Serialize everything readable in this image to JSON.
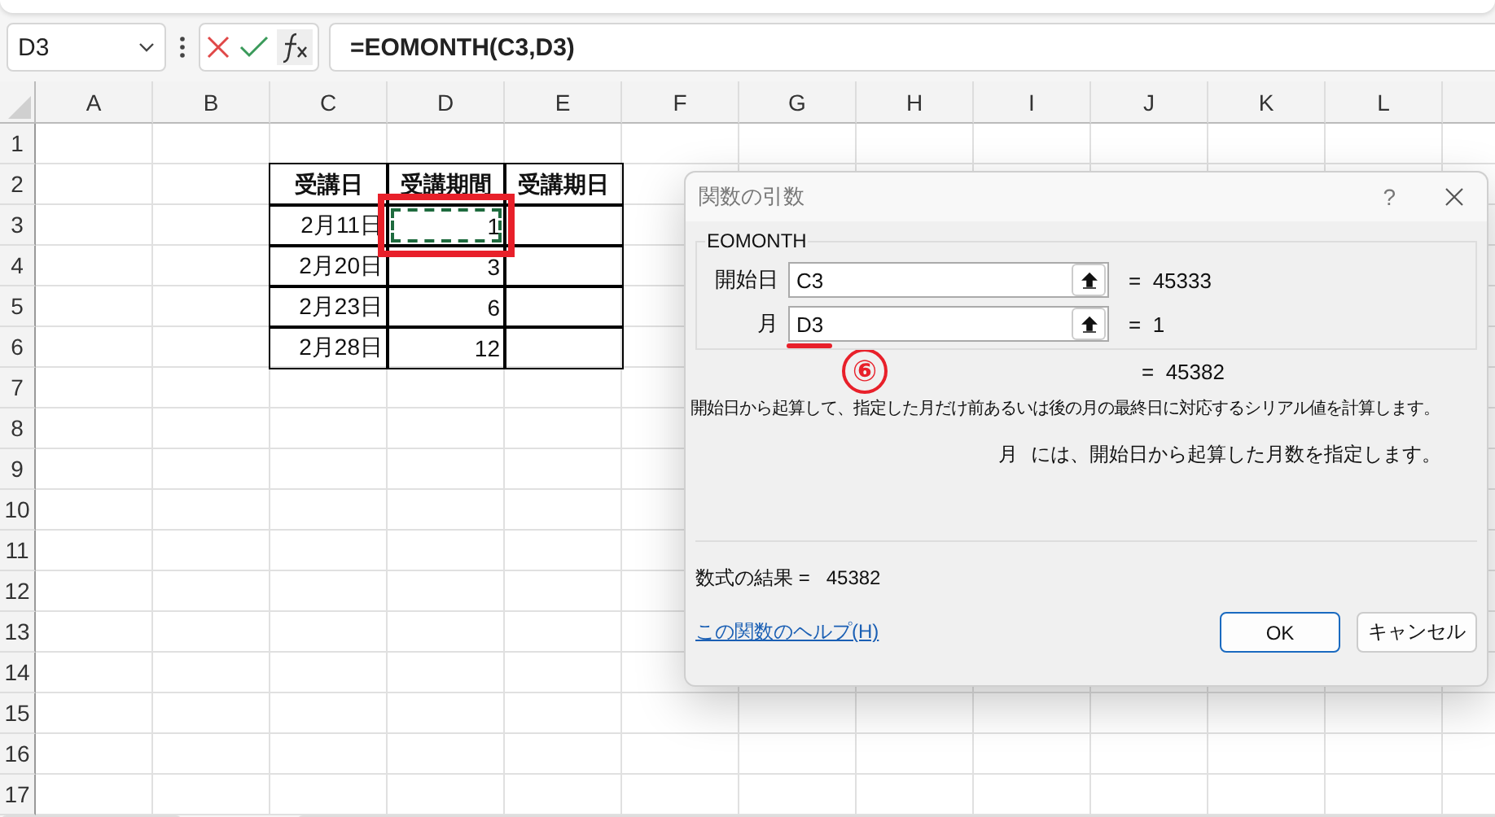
{
  "formula_bar": {
    "name_box": "D3",
    "formula": "=EOMONTH(C3,D3)"
  },
  "sheet": {
    "columns": [
      "A",
      "B",
      "C",
      "D",
      "E",
      "F",
      "G",
      "H",
      "I",
      "J",
      "K",
      "L"
    ],
    "rows": [
      "1",
      "2",
      "3",
      "4",
      "5",
      "6",
      "7",
      "8",
      "9",
      "10",
      "11",
      "12",
      "13",
      "14",
      "15",
      "16",
      "17"
    ],
    "table": {
      "headers": [
        "受講日",
        "受講期間",
        "受講期日"
      ],
      "rows": [
        {
          "date": "2月11日",
          "period": "1",
          "selected": true
        },
        {
          "date": "2月20日",
          "period": "3",
          "selected": false
        },
        {
          "date": "2月23日",
          "period": "6",
          "selected": false
        },
        {
          "date": "2月28日",
          "period": "12",
          "selected": false
        }
      ]
    }
  },
  "dialog": {
    "title": "関数の引数",
    "help": "?",
    "function_name": "EOMONTH",
    "arguments": [
      {
        "label": "開始日",
        "value": "C3",
        "result": "=  45333"
      },
      {
        "label": "月",
        "value": "D3",
        "result": "=  1"
      }
    ],
    "result": "=  45382",
    "description": "開始日から起算して、指定した月だけ前あるいは後の月の最終日に対応するシリアル値を計算します。",
    "argument_help": {
      "name": "月",
      "text": "には、開始日から起算した月数を指定します。"
    },
    "formula_result": "数式の結果 =   45382",
    "help_link": "この関数のヘルプ(H)",
    "buttons": [
      "OK",
      "キャンセル"
    ]
  },
  "annotation": {
    "step": "⑥"
  }
}
